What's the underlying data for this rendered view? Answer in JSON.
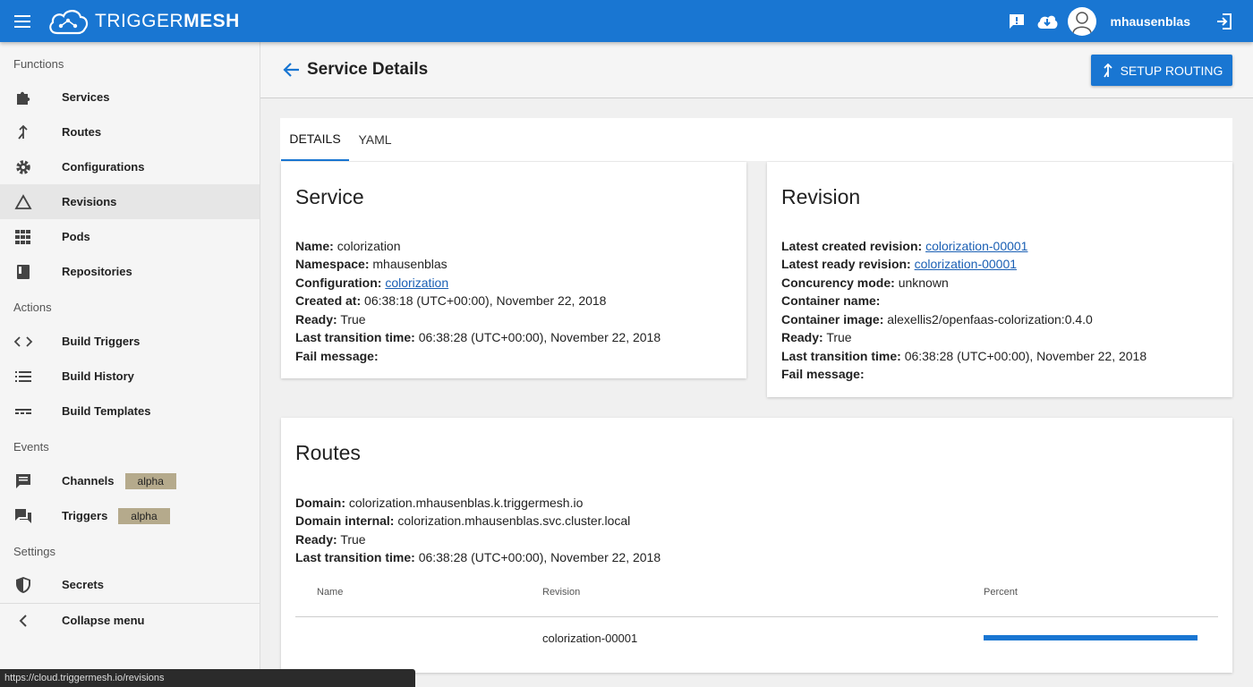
{
  "app": {
    "logo_regular": "TRIGGER",
    "logo_bold": "MESH",
    "username": "mhausenblas"
  },
  "sidebar": {
    "sections": {
      "functions": "Functions",
      "actions": "Actions",
      "events": "Events",
      "settings": "Settings"
    },
    "items": [
      {
        "label": "Services",
        "icon": "puzzle-icon"
      },
      {
        "label": "Routes",
        "icon": "merge-icon"
      },
      {
        "label": "Configurations",
        "icon": "gear-icon"
      },
      {
        "label": "Revisions",
        "icon": "triangle-icon"
      },
      {
        "label": "Pods",
        "icon": "grid-icon"
      },
      {
        "label": "Repositories",
        "icon": "book-icon"
      },
      {
        "label": "Build Triggers",
        "icon": "code-icon"
      },
      {
        "label": "Build History",
        "icon": "list-icon"
      },
      {
        "label": "Build Templates",
        "icon": "template-icon"
      },
      {
        "label": "Channels",
        "icon": "chat-icon",
        "badge": "alpha"
      },
      {
        "label": "Triggers",
        "icon": "forum-icon",
        "badge": "alpha"
      },
      {
        "label": "Secrets",
        "icon": "shield-icon"
      },
      {
        "label": "Collapse menu",
        "icon": "chevron-left-icon"
      }
    ]
  },
  "header": {
    "title": "Service Details",
    "setup_routing_label": "SETUP ROUTING"
  },
  "tabs": [
    "DETAILS",
    "YAML"
  ],
  "service": {
    "title": "Service",
    "fields": [
      {
        "label": "Name:",
        "value": "colorization"
      },
      {
        "label": "Namespace:",
        "value": "mhausenblas"
      },
      {
        "label": "Configuration:",
        "value": "",
        "link": "colorization"
      },
      {
        "label": "Created at:",
        "value": "06:38:18 (UTC+00:00), November 22, 2018"
      },
      {
        "label": "Ready:",
        "value": "True"
      },
      {
        "label": "Last transition time:",
        "value": "06:38:28 (UTC+00:00), November 22, 2018"
      },
      {
        "label": "Fail message:",
        "value": ""
      }
    ]
  },
  "revision": {
    "title": "Revision",
    "fields": [
      {
        "label": "Latest created revision:",
        "value": "",
        "link": "colorization-00001"
      },
      {
        "label": "Latest ready revision:",
        "value": "",
        "link": "colorization-00001"
      },
      {
        "label": "Concurency mode:",
        "value": "unknown"
      },
      {
        "label": "Container name:",
        "value": ""
      },
      {
        "label": "Container image:",
        "value": "alexellis2/openfaas-colorization:0.4.0"
      },
      {
        "label": "Ready:",
        "value": "True"
      },
      {
        "label": "Last transition time:",
        "value": "06:38:28 (UTC+00:00), November 22, 2018"
      },
      {
        "label": "Fail message:",
        "value": ""
      }
    ]
  },
  "routes": {
    "title": "Routes",
    "fields": [
      {
        "label": "Domain:",
        "value": "colorization.mhausenblas.k.triggermesh.io"
      },
      {
        "label": "Domain internal:",
        "value": "colorization.mhausenblas.svc.cluster.local"
      },
      {
        "label": "Ready:",
        "value": "True"
      },
      {
        "label": "Last transition time:",
        "value": "06:38:28 (UTC+00:00), November 22, 2018"
      }
    ],
    "columns": [
      "Name",
      "Revision",
      "Percent"
    ],
    "rows": [
      {
        "name": "",
        "revision": "colorization-00001",
        "percent": 100
      }
    ]
  },
  "status_url": "https://cloud.triggermesh.io/revisions",
  "colors": {
    "accent": "#1976d2",
    "badge": "#b5aa8c"
  }
}
